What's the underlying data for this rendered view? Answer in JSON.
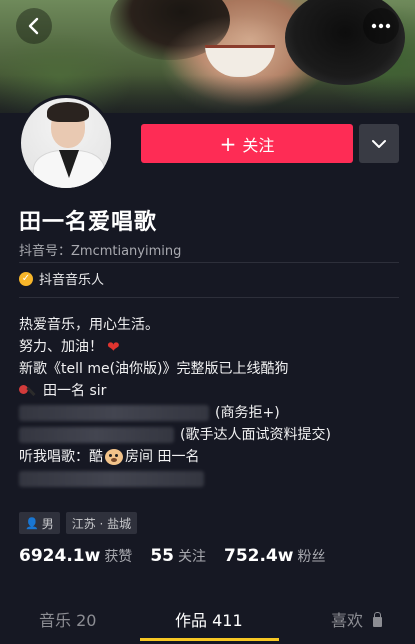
{
  "header": {
    "back_icon": "chevron-left-icon",
    "more_icon": "ellipsis-icon"
  },
  "profile": {
    "name": "田一名爱唱歌",
    "handle": "抖音号：Zmcmtianyiming",
    "verification": "抖音音乐人",
    "follow_label": "关注",
    "follow_color": "#fe2c55"
  },
  "bio": {
    "line1": "热爱音乐，用心生活。",
    "line2": "努力、加油！",
    "line3": "新歌《tell me(油你版)》完整版已上线酷狗",
    "line4": "田一名 sir",
    "line5": "(商务拒+)",
    "line6": "(歌手达人面试资料提交)",
    "line7_a": "听我唱歌：酷",
    "line7_b": "房间  田一名"
  },
  "tags": {
    "gender": "男",
    "location": "江苏 · 盐城"
  },
  "stats": {
    "likes_num": "6924.1w",
    "likes_label": "获赞",
    "following_num": "55",
    "following_label": "关注",
    "followers_num": "752.4w",
    "followers_label": "粉丝"
  },
  "tabs": {
    "music": "音乐 20",
    "works": "作品 411",
    "likes": "喜欢"
  },
  "colors": {
    "background": "#161823",
    "accent": "#fe2c55",
    "tab_indicator": "#f8c824"
  }
}
